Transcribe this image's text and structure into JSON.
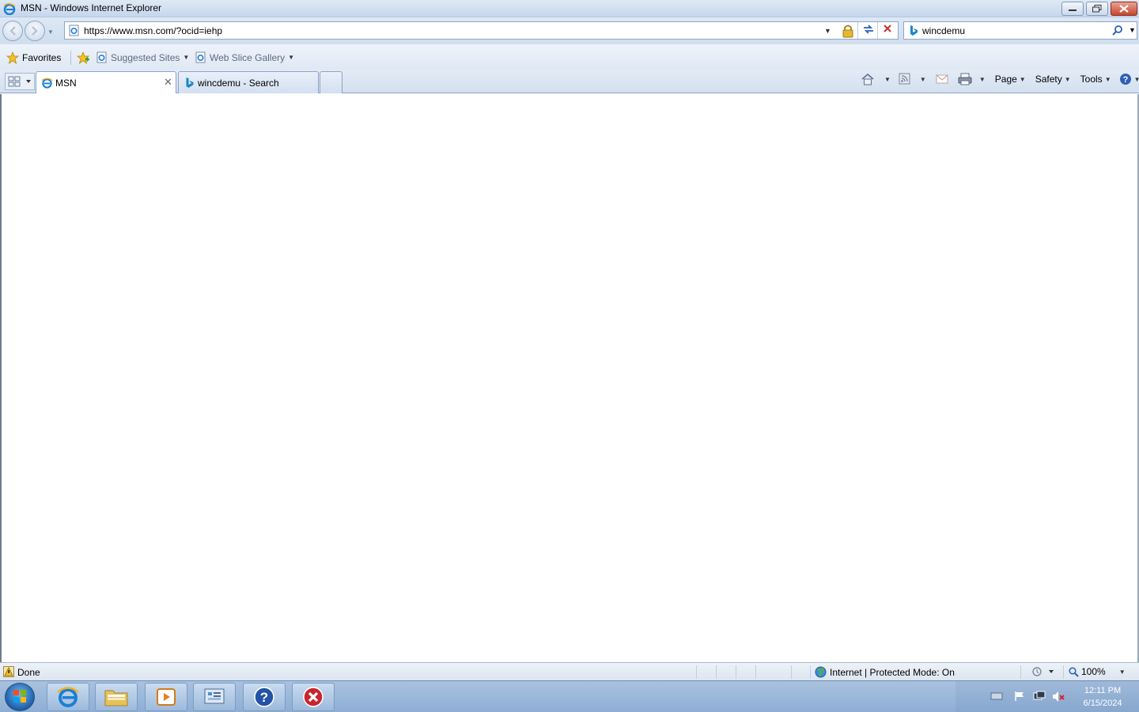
{
  "window": {
    "title": "MSN - Windows Internet Explorer"
  },
  "address_bar": {
    "url": "https://www.msn.com/?ocid=iehp"
  },
  "search_box": {
    "query": "wincdemu"
  },
  "favorites_bar": {
    "favorites_label": "Favorites",
    "items": [
      {
        "label": "Suggested Sites"
      },
      {
        "label": "Web Slice Gallery"
      }
    ]
  },
  "tabs": [
    {
      "label": "MSN",
      "active": true
    },
    {
      "label": "wincdemu - Search",
      "active": false
    }
  ],
  "command_bar": {
    "page_label": "Page",
    "safety_label": "Safety",
    "tools_label": "Tools"
  },
  "status_bar": {
    "status": "Done",
    "zone": "Internet | Protected Mode: On",
    "zoom": "100%"
  },
  "taskbar": {
    "time": "12:11 PM",
    "date": "6/15/2024"
  },
  "colors": {
    "accent": "#2a62b8",
    "close_button": "#c7452e"
  }
}
